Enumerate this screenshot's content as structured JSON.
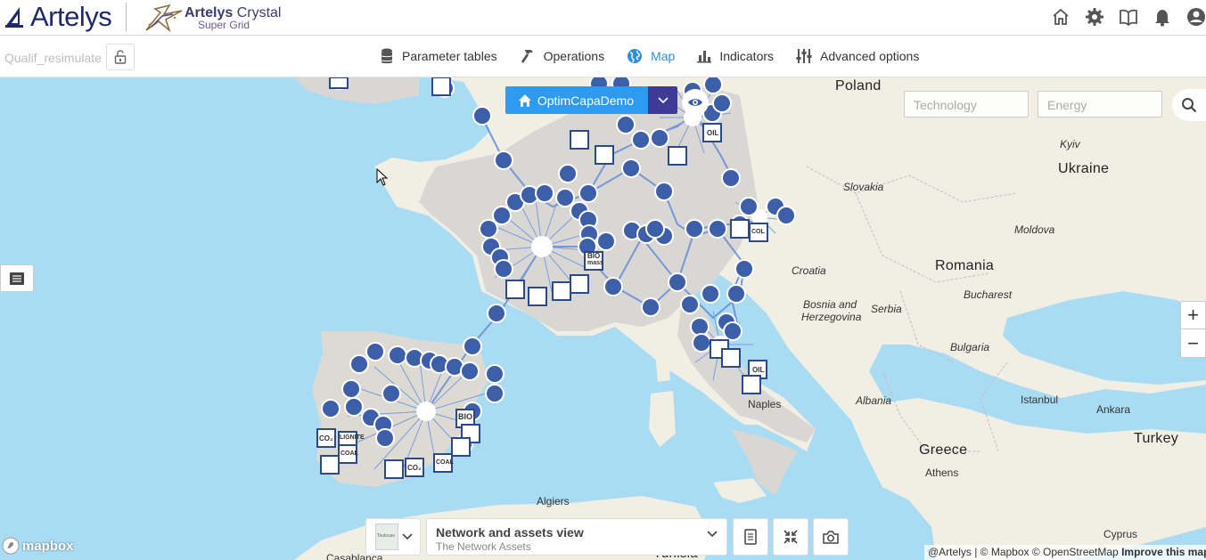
{
  "header": {
    "brand": "Artelys",
    "product_name": "Artelys",
    "product_name_suffix": "Crystal",
    "product_sub": "Super Grid",
    "icons": [
      "home-icon",
      "gear-icon",
      "book-icon",
      "bell-icon",
      "user-icon"
    ]
  },
  "toolbar": {
    "project_name": "Qualif_resimulate",
    "nav": [
      {
        "label": "Parameter tables",
        "icon": "database-icon",
        "active": false
      },
      {
        "label": "Operations",
        "icon": "hammer-icon",
        "active": false
      },
      {
        "label": "Map",
        "icon": "globe-icon",
        "active": true
      },
      {
        "label": "Indicators",
        "icon": "bar-chart-icon",
        "active": false
      },
      {
        "label": "Advanced options",
        "icon": "sliders-icon",
        "active": false
      }
    ]
  },
  "map": {
    "scenario_label": "OptimCapaDemo",
    "filters": {
      "technology_placeholder": "Technology",
      "energy_placeholder": "Energy"
    },
    "labels": {
      "poland": "Poland",
      "kyiv": "Kyiv",
      "ukraine": "Ukraine",
      "slovakia": "Slovakia",
      "moldova": "Moldova",
      "romania": "Romania",
      "croatia": "Croatia",
      "bucharest": "Bucharest",
      "bosnia1": "Bosnia and",
      "bosnia2": "Herzegovina",
      "serbia": "Serbia",
      "bulgaria": "Bulgaria",
      "naples": "Naples",
      "albania": "Albania",
      "istanbul": "Istanbul",
      "ankara": "Ankara",
      "turkey": "Turkey",
      "greece": "Greece",
      "athens": "Athens",
      "algiers": "Algiers",
      "tunisia": "Tunisia",
      "casablanca": "Casablanca",
      "cyprus": "Cyprus"
    },
    "asset_labels": {
      "oil": "OIL",
      "bio": "BIO",
      "mass": "mass",
      "lignite": "LIGNITE",
      "coal": "COAL",
      "co2": "CO₂",
      "col": "COL"
    },
    "zoom_in": "+",
    "zoom_out": "−",
    "view": {
      "title": "Network and assets view",
      "subtitle": "The Network Assets",
      "thumb_label": "Toulouse"
    },
    "mapbox_label": "mapbox",
    "attribution": "@Artelys | © Mapbox © OpenStreetMap",
    "improve_link": "Improve this map"
  }
}
